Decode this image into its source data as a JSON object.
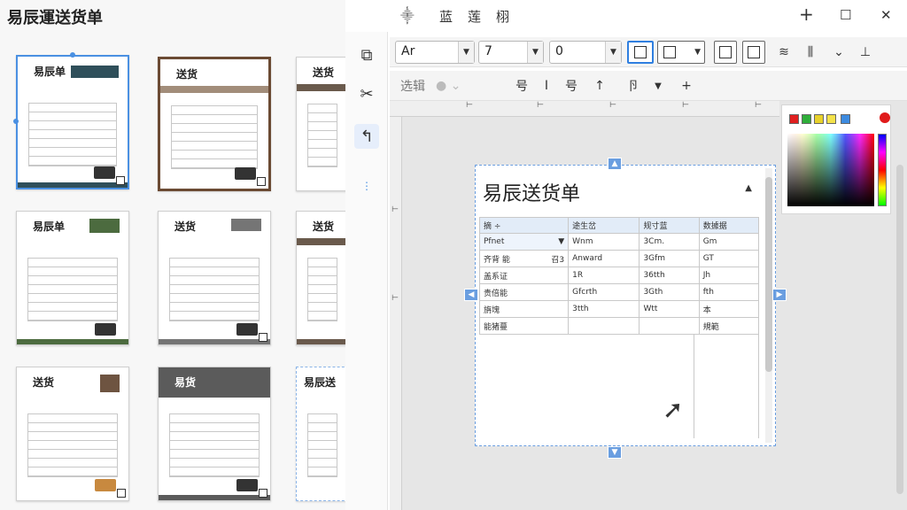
{
  "app": {
    "title": "易辰運送货单"
  },
  "window_bar": {
    "center_items": [
      "⸎",
      "蓝",
      "莲",
      "栩"
    ],
    "add": "+",
    "restore": "☐",
    "close": "✕"
  },
  "gallery": {
    "templates": [
      {
        "title": "易辰单",
        "band": "#2f4f5a"
      },
      {
        "title": "送货",
        "band": "#a28d7a"
      },
      {
        "title": "送货",
        "band": "#6a5a4c"
      },
      {
        "title": "易辰单",
        "band": "#4c6b3f"
      },
      {
        "title": "送货",
        "band": "#757575"
      },
      {
        "title": "送货",
        "band": "#6a5a4c"
      },
      {
        "title": "送货",
        "band": "#6e5441"
      },
      {
        "title": "易货",
        "band": "#5b5b5b"
      },
      {
        "title": "易辰送",
        "band": "#ffffff"
      }
    ],
    "scroll_down": "▼"
  },
  "rail": {
    "tools": [
      "⧉",
      "✂",
      "↰",
      "⋮"
    ]
  },
  "toolbar1": {
    "font_name": "Ar",
    "font_size": "7",
    "spacing": "0",
    "icons": [
      "≋",
      "⫼",
      "⌄",
      "⊥"
    ]
  },
  "toolbar2": {
    "select_label": "选辑",
    "icons": [
      "号",
      "I",
      "号",
      "↑",
      "卪",
      "+"
    ]
  },
  "ruler": {
    "ticks": [
      "⊢",
      "⊢",
      "⊢",
      "⊢",
      "⊢",
      "⊢",
      "⊢"
    ]
  },
  "document": {
    "title": "易辰送货单",
    "collapse": "▲",
    "headers": [
      "摘 ÷",
      "途生岔",
      "规寸蓝",
      "数據据"
    ],
    "rows": [
      [
        "Pfnet",
        "Wnm",
        "3Cm.",
        "Gm"
      ],
      [
        "齐背 能",
        "Anward",
        "3Gfm",
        "GT"
      ],
      [
        "盖系证",
        "1R",
        "36tth",
        "Jh"
      ],
      [
        "贵倍能",
        "Gfcrth",
        "3Gth",
        "fth"
      ],
      [
        "旃塊",
        "3tth",
        "Wtt",
        "本"
      ],
      [
        "能猪蔓",
        "",
        "",
        "規範"
      ]
    ],
    "row_extra": [
      "▼",
      "召3"
    ]
  },
  "picker": {
    "swatches": [
      "#e02020",
      "#2fae3a",
      "#e8d12b",
      "#f4e24a",
      "#3d8be0"
    ]
  }
}
